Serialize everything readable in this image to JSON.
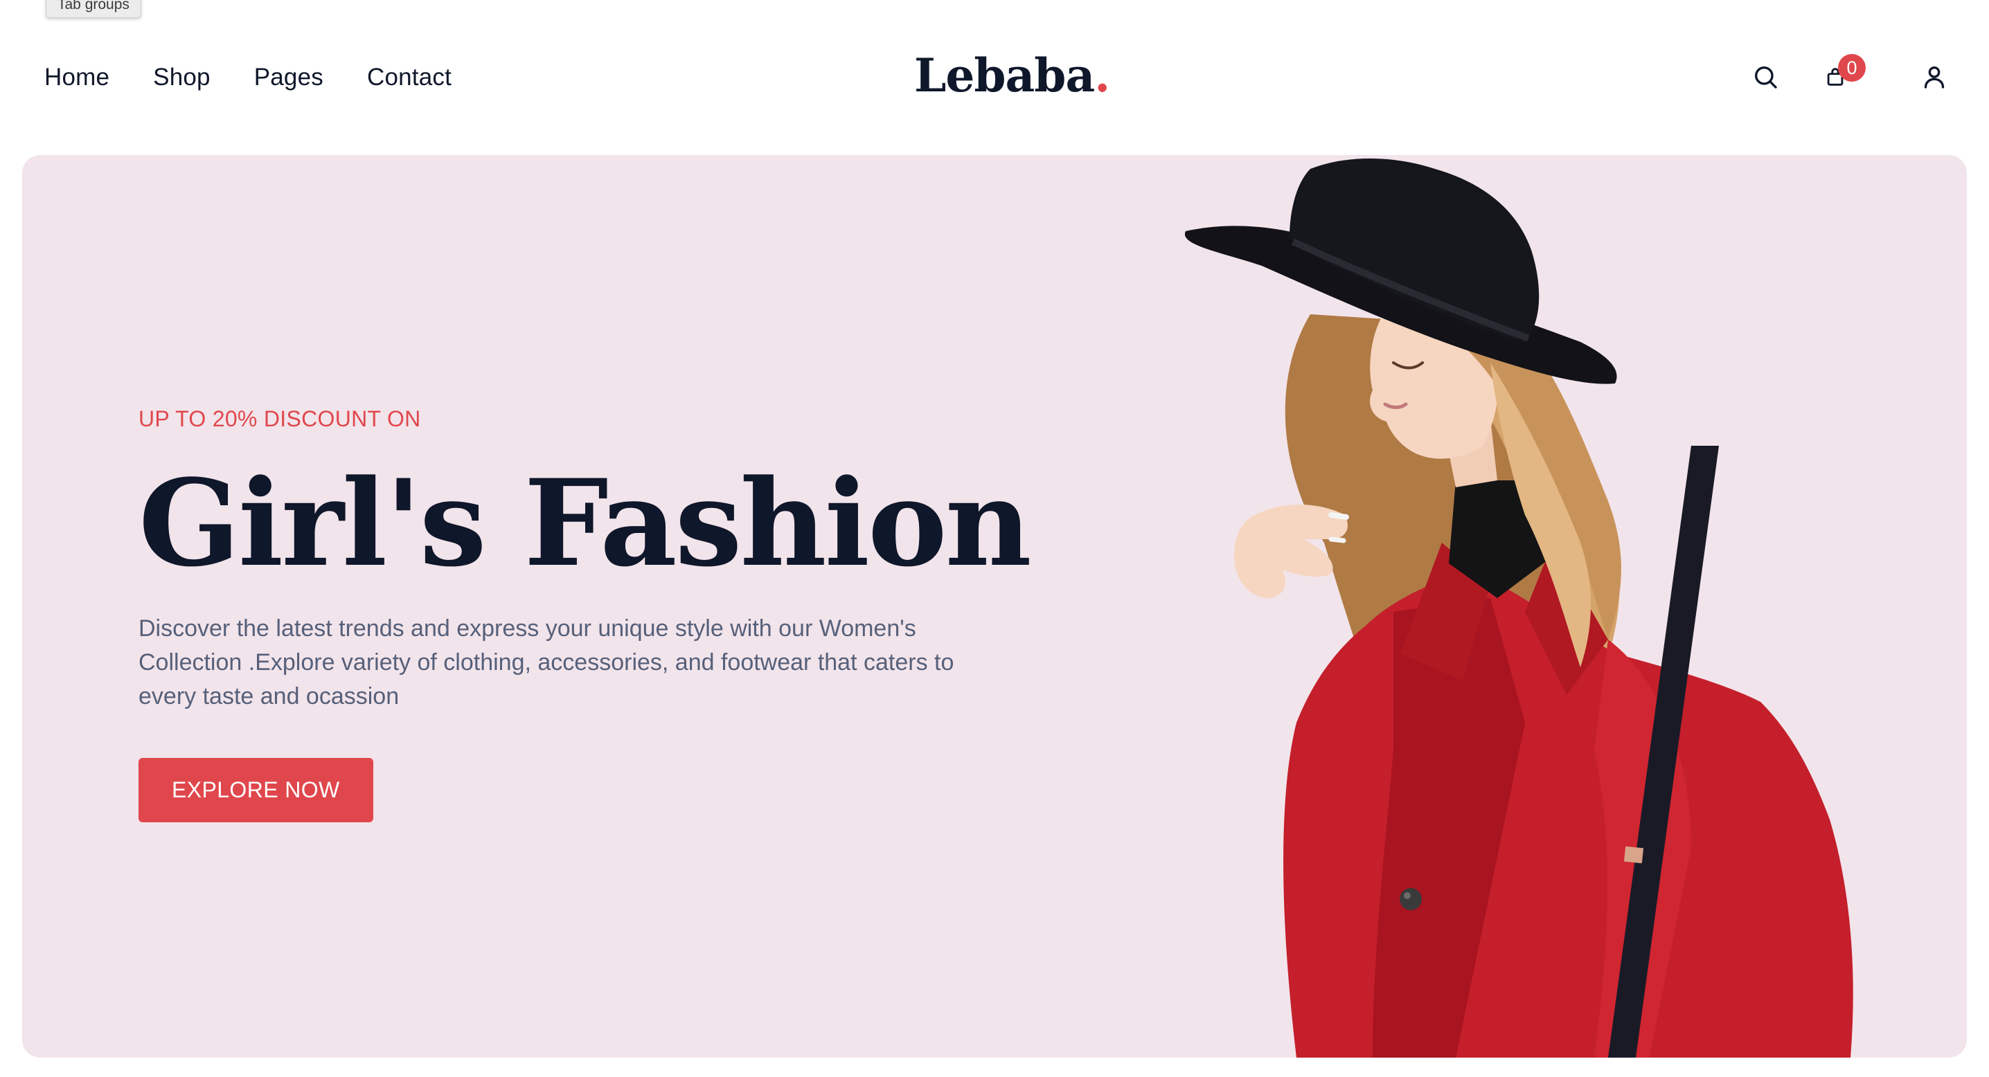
{
  "tooltip": {
    "text": "Tab groups"
  },
  "nav": {
    "items": [
      {
        "label": "Home"
      },
      {
        "label": "Shop"
      },
      {
        "label": "Pages"
      },
      {
        "label": "Contact"
      }
    ]
  },
  "logo": {
    "text": "Lebaba",
    "dot": "."
  },
  "header_icons": {
    "search": "search-icon",
    "cart": "shopping-bag-icon",
    "cart_count": "0",
    "user": "user-icon"
  },
  "hero": {
    "eyebrow": "UP TO 20% DISCOUNT ON",
    "title": "Girl's Fashion",
    "description": "Discover the latest trends and express your unique style with our Women's Collection .Explore variety of clothing, accessories, and footwear that caters to every taste and ocassion",
    "cta_label": "EXPLORE NOW"
  },
  "colors": {
    "accent": "#e0474c",
    "hero_bg": "#f2e4eb",
    "text_dark": "#0f172a",
    "text_muted": "#56607a"
  }
}
